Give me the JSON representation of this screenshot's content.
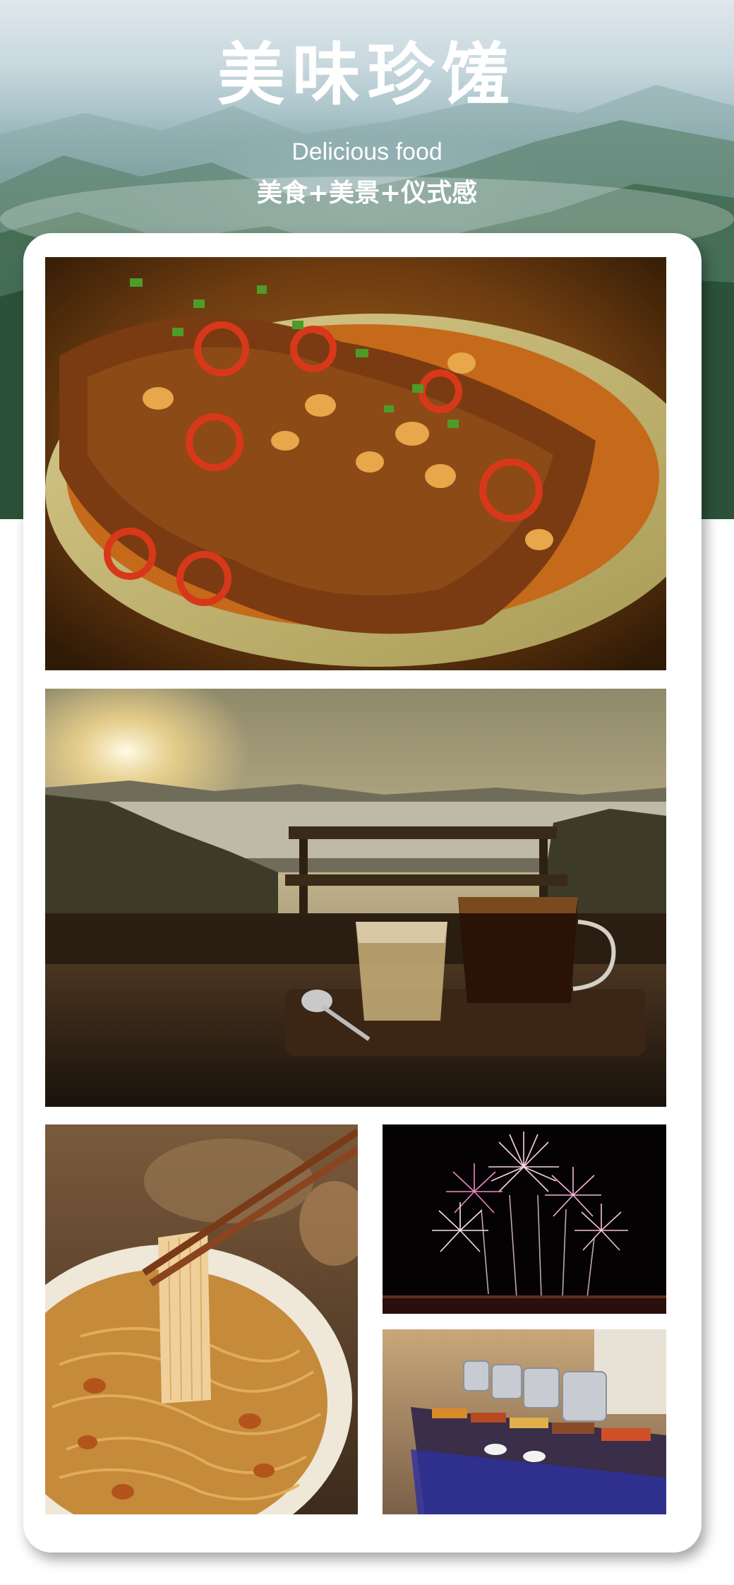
{
  "header": {
    "title": "美味珍馐",
    "subtitle_en": "Delicious food",
    "tagline": "美食+美景+仪式感"
  },
  "theme": {
    "title_color": "#ffffff",
    "card_background": "#ffffff",
    "mountain_green": "#2f5640"
  },
  "photos": [
    {
      "subject": "braised fish with chili and soybeans"
    },
    {
      "subject": "sunrise mountain view with tea and coffee"
    },
    {
      "subject": "noodles lifted with chopsticks"
    },
    {
      "subject": "fireworks at night"
    },
    {
      "subject": "buffet counter with chafing dishes"
    }
  ]
}
